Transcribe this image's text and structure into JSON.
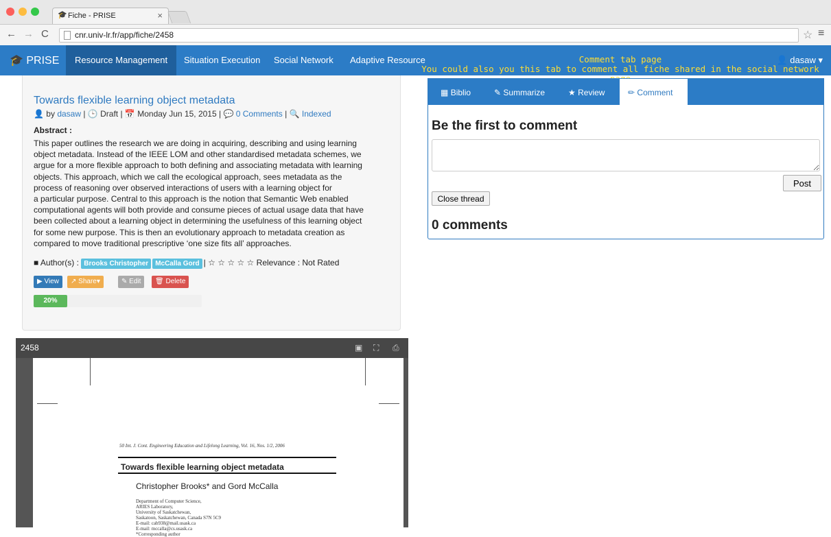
{
  "browser": {
    "tab_title": "Fiche - PRISE",
    "tab_close": "×",
    "url": "cnr.univ-lr.fr/app/fiche/2458"
  },
  "nav": {
    "brand": "PRISE",
    "items": [
      "Resource Management",
      "Situation Execution",
      "Social Network",
      "Adaptive Resource"
    ],
    "active_index": 0,
    "user": "dasaw"
  },
  "annotation": {
    "title": "Comment tab page",
    "text": "You could also you this tab to comment all fiche shared in the social network page"
  },
  "fiche": {
    "title": "Towards flexible learning object metadata",
    "by_label": "by",
    "author": "dasaw",
    "status": "Draft",
    "date": "Monday Jun 15, 2015",
    "comments_link": "0 Comments",
    "indexed": "Indexed",
    "abstract_heading": "Abstract :",
    "abstract": [
      "This paper outlines the research we are doing in acquiring, describing and using learning",
      "object metadata. Instead of the IEEE LOM and other standardised metadata schemes, we",
      "argue for a more flexible approach to both defining and associating metadata with learning",
      "objects. This approach, which we call the ecological approach, sees metadata as the",
      "process of reasoning over observed interactions of users with a learning object for",
      "a particular purpose. Central to this approach is the notion that Semantic Web enabled",
      "computational agents will both provide and consume pieces of actual usage data that have",
      "been collected about a learning object in determining the usefulness of this learning object",
      "for some new purpose. This is then an evolutionary approach to metadata creation as",
      "compared to move traditional prescriptive ‘one size fits all’ approaches."
    ],
    "authors_label": "Author(s) :",
    "authors": [
      "Brooks Christopher",
      "McCalla Gord"
    ],
    "relevance": "Relevance : Not Rated",
    "stars": 0,
    "buttons": {
      "view": "View",
      "share": "Share",
      "edit": "Edit",
      "delete": "Delete"
    },
    "progress_label": "20%",
    "progress": 0.2
  },
  "pdf": {
    "name": "2458",
    "journal": "50    Int. J. Cont. Engineering Education and Lifelong Learning, Vol. 16, Nos. 1/2, 2006",
    "title": "Towards flexible learning object metadata",
    "authors": "Christopher Brooks* and Gord McCalla",
    "affiliation": [
      "Department of Computer Science,",
      "ARIES Laboratory,",
      "University of Saskatchewan,",
      "Saskatoon, Saskatchewan, Canada S7N 5C9",
      "E-mail: cab938@mail.usask.ca",
      "E-mail: mccalla@cs.usask.ca",
      "*Corresponding author"
    ]
  },
  "comment_panel": {
    "tabs": [
      "Biblio",
      "Summarize",
      "Review",
      "Comment"
    ],
    "active_tab": 3,
    "heading": "Be the first to comment",
    "post": "Post",
    "close_thread": "Close thread",
    "count": "0 comments"
  },
  "colors": {
    "accent": "#2c7cc6",
    "annotation": "#ffde33"
  }
}
